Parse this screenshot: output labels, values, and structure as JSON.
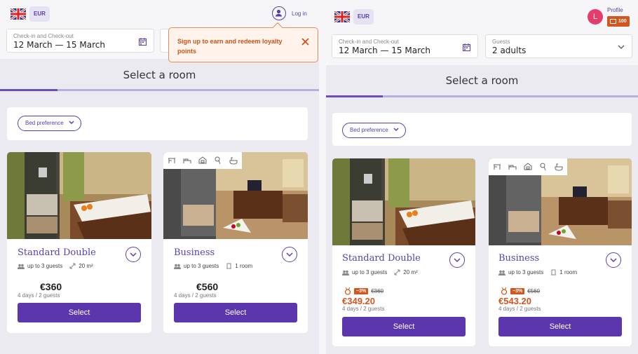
{
  "left": {
    "currency": "EUR",
    "login_label": "Log in",
    "dates_label": "Check-in and Check-out",
    "dates_value": "12 March — 15 March",
    "tooltip": "Sign up to earn and redeem loyalty points",
    "page_title": "Select a room",
    "bed_preference": "Bed preference",
    "rooms": [
      {
        "name": "Standard Double",
        "guests": "up to 3 guests",
        "size": "20 m²",
        "price": "€360",
        "nights": "4 days / 2 guests",
        "select": "Select"
      },
      {
        "name": "Business",
        "guests": "up to 3 guests",
        "rooms": "1 room",
        "price": "€560",
        "nights": "4 days / 2 guests",
        "select": "Select"
      }
    ]
  },
  "right": {
    "currency": "EUR",
    "profile_initial": "L",
    "profile_label": "Profile",
    "points": "100",
    "dates_label": "Check-in and Check-out",
    "dates_value": "12 March — 15 March",
    "guests_label": "Guests",
    "guests_value": "2 adults",
    "page_title": "Select a room",
    "bed_preference": "Bed preference",
    "rooms": [
      {
        "name": "Standard Double",
        "guests": "up to 3 guests",
        "size": "20 m²",
        "discount": "−3%",
        "old_price": "€360",
        "price": "€349.20",
        "nights": "4 days / 2 guests",
        "select": "Select"
      },
      {
        "name": "Business",
        "guests": "up to 3 guests",
        "rooms": "1 room",
        "discount": "−3%",
        "old_price": "€560",
        "price": "€543.20",
        "nights": "4 days / 2 guests",
        "select": "Select"
      }
    ]
  },
  "colors": {
    "accent": "#5b36ad",
    "discount": "#d4561e",
    "avatar": "#e43d6c"
  }
}
